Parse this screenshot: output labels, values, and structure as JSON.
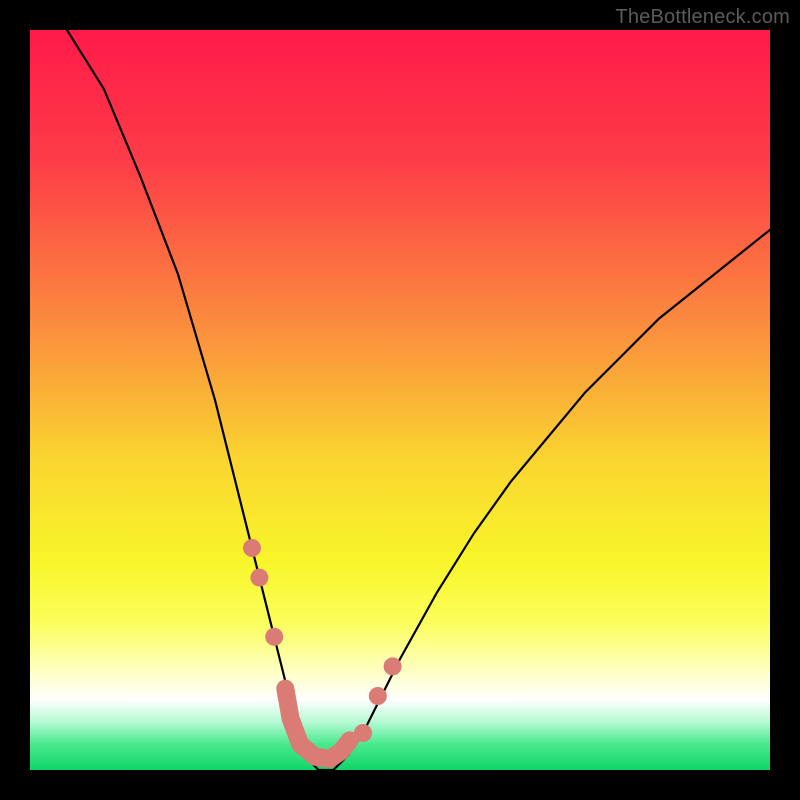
{
  "watermark": {
    "text": "TheBottleneck.com"
  },
  "chart_data": {
    "type": "line",
    "title": "",
    "xlabel": "",
    "ylabel": "",
    "xlim": [
      0,
      100
    ],
    "ylim": [
      0,
      100
    ],
    "x": [
      5,
      10,
      15,
      20,
      25,
      28,
      30,
      32,
      34,
      35,
      36,
      37,
      38,
      39,
      40,
      41,
      42,
      43,
      45,
      47,
      50,
      55,
      60,
      65,
      70,
      75,
      80,
      85,
      90,
      95,
      100
    ],
    "values": [
      100,
      92,
      80,
      67,
      50,
      38,
      30,
      22,
      14,
      10,
      6,
      3,
      1,
      0,
      0,
      0,
      1,
      2,
      5,
      9,
      15,
      24,
      32,
      39,
      45,
      51,
      56,
      61,
      65,
      69,
      73
    ],
    "annotations": {
      "marker_color": "#da7b75",
      "markers": [
        {
          "x": 30,
          "y": 30
        },
        {
          "x": 31,
          "y": 26
        },
        {
          "x": 33,
          "y": 18
        },
        {
          "x": 45,
          "y": 5
        },
        {
          "x": 47,
          "y": 10
        },
        {
          "x": 49,
          "y": 14
        }
      ],
      "worm": [
        {
          "x": 34.5,
          "y": 11
        },
        {
          "x": 35.2,
          "y": 7
        },
        {
          "x": 36.5,
          "y": 3.5
        },
        {
          "x": 38.5,
          "y": 1.8
        },
        {
          "x": 40.5,
          "y": 1.5
        },
        {
          "x": 42.0,
          "y": 2.5
        },
        {
          "x": 43.2,
          "y": 4.0
        }
      ]
    },
    "gradient_stops": [
      {
        "offset": 0.0,
        "color": "#fe1a4a"
      },
      {
        "offset": 0.18,
        "color": "#fd3d47"
      },
      {
        "offset": 0.4,
        "color": "#fb8d3e"
      },
      {
        "offset": 0.58,
        "color": "#fad530"
      },
      {
        "offset": 0.72,
        "color": "#f8f62a"
      },
      {
        "offset": 0.8,
        "color": "#fbfe5b"
      },
      {
        "offset": 0.86,
        "color": "#feffb8"
      },
      {
        "offset": 0.905,
        "color": "#ffffff"
      },
      {
        "offset": 0.935,
        "color": "#b6fad3"
      },
      {
        "offset": 0.965,
        "color": "#4ae98e"
      },
      {
        "offset": 1.0,
        "color": "#0fd668"
      }
    ]
  }
}
